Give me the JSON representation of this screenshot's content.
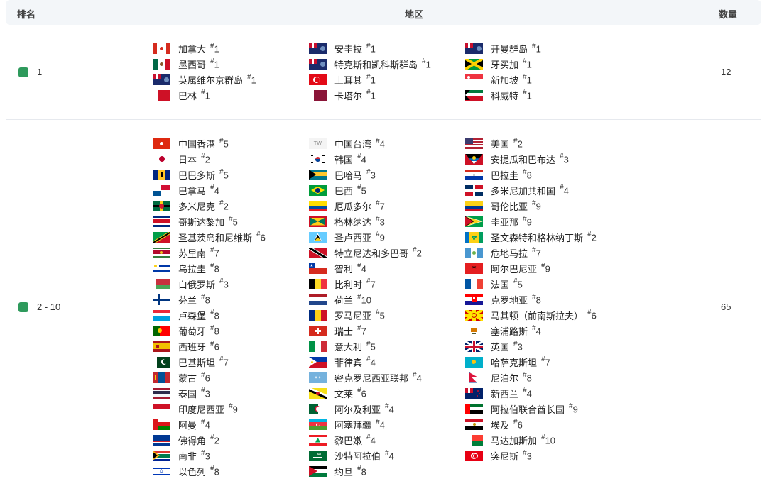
{
  "header": {
    "rank": "排名",
    "region": "地区",
    "count": "数量"
  },
  "rows": [
    {
      "rank": "1",
      "count": "12",
      "columns": [
        [
          {
            "name": "加拿大",
            "n": "1",
            "flag": "ca"
          },
          {
            "name": "墨西哥",
            "n": "1",
            "flag": "mx"
          },
          {
            "name": "英属维尔京群岛",
            "n": "1",
            "flag": "blueensign"
          },
          {
            "name": "巴林",
            "n": "1",
            "flag": "bh"
          }
        ],
        [
          {
            "name": "安圭拉",
            "n": "1",
            "flag": "blueensign"
          },
          {
            "name": "特克斯和凯科斯群岛",
            "n": "1",
            "flag": "blueensign"
          },
          {
            "name": "土耳其",
            "n": "1",
            "flag": "tr"
          },
          {
            "name": "卡塔尔",
            "n": "1",
            "flag": "qa"
          }
        ],
        [
          {
            "name": "开曼群岛",
            "n": "1",
            "flag": "blueensign"
          },
          {
            "name": "牙买加",
            "n": "1",
            "flag": "jm"
          },
          {
            "name": "新加坡",
            "n": "1",
            "flag": "sg"
          },
          {
            "name": "科威特",
            "n": "1",
            "flag": "kw"
          }
        ]
      ]
    },
    {
      "rank": "2 - 10",
      "count": "65",
      "columns": [
        [
          {
            "name": "中国香港",
            "n": "5",
            "flag": "hk"
          },
          {
            "name": "日本",
            "n": "2",
            "flag": "jp"
          },
          {
            "name": "巴巴多斯",
            "n": "5",
            "flag": "bb"
          },
          {
            "name": "巴拿马",
            "n": "4",
            "flag": "pa"
          },
          {
            "name": "多米尼克",
            "n": "2",
            "flag": "dm"
          },
          {
            "name": "哥斯达黎加",
            "n": "5",
            "flag": "cr"
          },
          {
            "name": "圣基茨岛和尼维斯",
            "n": "6",
            "flag": "kn"
          },
          {
            "name": "苏里南",
            "n": "7",
            "flag": "sr"
          },
          {
            "name": "乌拉圭",
            "n": "8",
            "flag": "uy"
          },
          {
            "name": "白俄罗斯",
            "n": "3",
            "flag": "by"
          },
          {
            "name": "芬兰",
            "n": "8",
            "flag": "fi"
          },
          {
            "name": "卢森堡",
            "n": "8",
            "flag": "lu"
          },
          {
            "name": "葡萄牙",
            "n": "8",
            "flag": "pt"
          },
          {
            "name": "西班牙",
            "n": "6",
            "flag": "es"
          },
          {
            "name": "巴基斯坦",
            "n": "7",
            "flag": "pk"
          },
          {
            "name": "蒙古",
            "n": "6",
            "flag": "mn"
          },
          {
            "name": "泰国",
            "n": "3",
            "flag": "th"
          },
          {
            "name": "印度尼西亚",
            "n": "9",
            "flag": "id"
          },
          {
            "name": "阿曼",
            "n": "4",
            "flag": "om"
          },
          {
            "name": "佛得角",
            "n": "2",
            "flag": "cv"
          },
          {
            "name": "南非",
            "n": "3",
            "flag": "za"
          },
          {
            "name": "以色列",
            "n": "8",
            "flag": "il"
          }
        ],
        [
          {
            "name": "中国台湾",
            "n": "4",
            "flag": "tw"
          },
          {
            "name": "韩国",
            "n": "4",
            "flag": "kr"
          },
          {
            "name": "巴哈马",
            "n": "3",
            "flag": "bs"
          },
          {
            "name": "巴西",
            "n": "5",
            "flag": "br"
          },
          {
            "name": "厄瓜多尔",
            "n": "7",
            "flag": "ec"
          },
          {
            "name": "格林纳达",
            "n": "3",
            "flag": "gd"
          },
          {
            "name": "圣卢西亚",
            "n": "9",
            "flag": "lc"
          },
          {
            "name": "特立尼达和多巴哥",
            "n": "2",
            "flag": "tt"
          },
          {
            "name": "智利",
            "n": "4",
            "flag": "cl"
          },
          {
            "name": "比利时",
            "n": "7",
            "flag": "be"
          },
          {
            "name": "荷兰",
            "n": "10",
            "flag": "nl"
          },
          {
            "name": "罗马尼亚",
            "n": "5",
            "flag": "ro"
          },
          {
            "name": "瑞士",
            "n": "7",
            "flag": "ch"
          },
          {
            "name": "意大利",
            "n": "5",
            "flag": "it"
          },
          {
            "name": "菲律宾",
            "n": "4",
            "flag": "ph"
          },
          {
            "name": "密克罗尼西亚联邦",
            "n": "4",
            "flag": "fm"
          },
          {
            "name": "文莱",
            "n": "6",
            "flag": "bn"
          },
          {
            "name": "阿尔及利亚",
            "n": "4",
            "flag": "dz"
          },
          {
            "name": "阿塞拜疆",
            "n": "4",
            "flag": "az"
          },
          {
            "name": "黎巴嫩",
            "n": "4",
            "flag": "lb"
          },
          {
            "name": "沙特阿拉伯",
            "n": "4",
            "flag": "sa"
          },
          {
            "name": "约旦",
            "n": "8",
            "flag": "jo"
          }
        ],
        [
          {
            "name": "美国",
            "n": "2",
            "flag": "us"
          },
          {
            "name": "安提瓜和巴布达",
            "n": "3",
            "flag": "ag"
          },
          {
            "name": "巴拉圭",
            "n": "8",
            "flag": "py"
          },
          {
            "name": "多米尼加共和国",
            "n": "4",
            "flag": "do"
          },
          {
            "name": "哥伦比亚",
            "n": "9",
            "flag": "co"
          },
          {
            "name": "圭亚那",
            "n": "9",
            "flag": "gy"
          },
          {
            "name": "圣文森特和格林纳丁斯",
            "n": "2",
            "flag": "vc"
          },
          {
            "name": "危地马拉",
            "n": "7",
            "flag": "gt"
          },
          {
            "name": "阿尔巴尼亚",
            "n": "9",
            "flag": "al"
          },
          {
            "name": "法国",
            "n": "5",
            "flag": "fr"
          },
          {
            "name": "克罗地亚",
            "n": "8",
            "flag": "hr"
          },
          {
            "name": "马其顿（前南斯拉夫）",
            "n": "6",
            "flag": "mk"
          },
          {
            "name": "塞浦路斯",
            "n": "4",
            "flag": "cy"
          },
          {
            "name": "英国",
            "n": "3",
            "flag": "gb"
          },
          {
            "name": "哈萨克斯坦",
            "n": "7",
            "flag": "kz"
          },
          {
            "name": "尼泊尔",
            "n": "8",
            "flag": "np"
          },
          {
            "name": "新西兰",
            "n": "4",
            "flag": "nz"
          },
          {
            "name": "阿拉伯联合酋长国",
            "n": "9",
            "flag": "ae"
          },
          {
            "name": "埃及",
            "n": "6",
            "flag": "eg"
          },
          {
            "name": "马达加斯加",
            "n": "10",
            "flag": "mg"
          },
          {
            "name": "突尼斯",
            "n": "3",
            "flag": "tn"
          }
        ]
      ]
    }
  ],
  "rank_color": "#2e9a5c",
  "tw_flag_text": "TW"
}
